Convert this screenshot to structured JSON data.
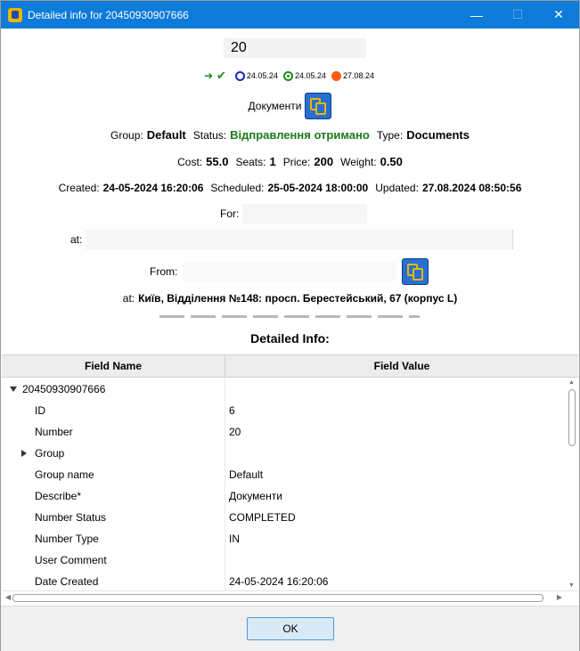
{
  "window": {
    "title": "Detailed info for 20450930907666",
    "minimize_glyph": "—",
    "maximize_glyph": "☐",
    "close_glyph": "✕"
  },
  "header": {
    "number": "20",
    "status_icons": {
      "login_icon": "login-arrow",
      "check_icon": "checkmark",
      "dates": [
        {
          "icon": "circle-open-blue",
          "date": "24.05.24"
        },
        {
          "icon": "circle-dot-green",
          "date": "24.05.24"
        },
        {
          "icon": "circle-filled-orange",
          "date": "27.08.24"
        }
      ]
    },
    "documents_label": "Документи"
  },
  "summary": {
    "group_label": "Group:",
    "group_value": "Default",
    "status_label": "Status:",
    "status_value": "Відправлення отримано",
    "type_label": "Type:",
    "type_value": "Documents",
    "cost_label": "Cost:",
    "cost_value": "55.0",
    "seats_label": "Seats:",
    "seats_value": "1",
    "price_label": "Price:",
    "price_value": "200",
    "weight_label": "Weight:",
    "weight_value": "0.50",
    "created_label": "Created:",
    "created_value": "24-05-2024 16:20:06",
    "scheduled_label": "Scheduled:",
    "scheduled_value": "25-05-2024 18:00:00",
    "updated_label": "Updated:",
    "updated_value": "27.08.2024 08:50:56",
    "for_label": "For:",
    "at_label": "at:",
    "from_label": "From:",
    "at2_label": "at:",
    "at2_value": "Київ, Відділення №148: просп. Берестейський, 67 (корпус L)",
    "detailed_title": "Detailed Info:"
  },
  "table": {
    "headers": [
      "Field Name",
      "Field Value"
    ],
    "root": "20450930907666",
    "rows": [
      {
        "name": "ID",
        "value": "6"
      },
      {
        "name": "Number",
        "value": "20"
      },
      {
        "name": "Group",
        "value": ""
      },
      {
        "name": "Group name",
        "value": "Default"
      },
      {
        "name": "Describe*",
        "value": "Документи"
      },
      {
        "name": "Number Status",
        "value": "COMPLETED"
      },
      {
        "name": "Number Type",
        "value": "IN"
      },
      {
        "name": "User Comment",
        "value": ""
      },
      {
        "name": "Date Created",
        "value": "24-05-2024 16:20:06"
      }
    ]
  },
  "footer": {
    "ok_label": "OK"
  },
  "colors": {
    "titlebar": "#0e7ad9",
    "status_green": "#1a7a1a",
    "accent_orange": "#ff5a10",
    "accent_blue": "#1428c8"
  }
}
